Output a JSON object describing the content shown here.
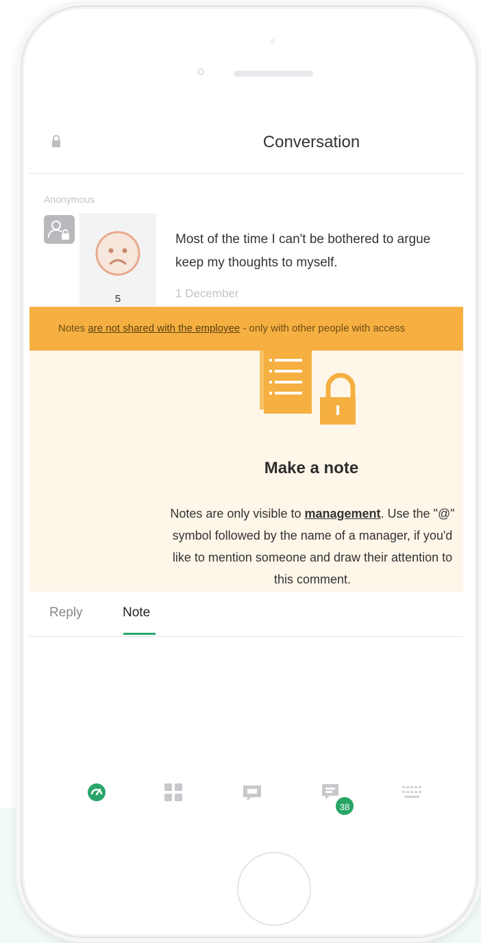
{
  "header": {
    "title": "Conversation"
  },
  "comment": {
    "author": "Anonymous",
    "rating": "5",
    "message_line1": "Most of the time I can't be bothered to argue",
    "message_line2": "keep my thoughts to myself.",
    "date": "1 December"
  },
  "banner": {
    "prefix": "Notes ",
    "link": "are not shared with the employee",
    "suffix": " - only with other people with access"
  },
  "note": {
    "title": "Make a note",
    "body_part1": "Notes are only visible to ",
    "body_link": "management",
    "body_part2": ". Use the \"@\" symbol followed by the name of a manager, if you'd like to mention someone and draw their attention to this comment."
  },
  "tabs": {
    "reply": "Reply",
    "note": "Note",
    "active": "Note"
  },
  "nav": {
    "items": [
      "dashboard-icon",
      "grid-icon",
      "chat-icon",
      "messages-icon",
      "keyboard-icon"
    ],
    "messages_badge": "38"
  },
  "colors": {
    "accent": "#2aa66a",
    "banner": "#f5b041",
    "note_bg": "#fef6e9"
  }
}
